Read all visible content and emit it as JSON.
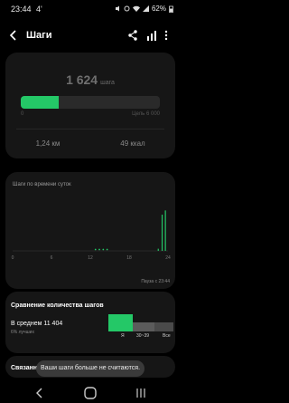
{
  "status_bar": {
    "time": "23:44",
    "notification": "4'",
    "battery": "62%"
  },
  "app_bar": {
    "title": "Шаги"
  },
  "summary": {
    "steps": "1 624",
    "steps_unit": "шага",
    "progress_start": "0",
    "goal": "Цель 6 000",
    "progress_fraction": 0.27,
    "distance": "1,24 км",
    "calories": "49 ккал",
    "accent_color": "#24c867"
  },
  "chart": {
    "title": "Шаги по времени суток",
    "pause": "Пауза с 23:44"
  },
  "chart_data": {
    "type": "bar",
    "x_ticks": [
      "0",
      "6",
      "12",
      "18",
      "24"
    ],
    "xlim": [
      0,
      24
    ],
    "bars": [
      {
        "hour": 22.5,
        "level": 0.05
      },
      {
        "hour": 23.1,
        "level": 0.85
      },
      {
        "hour": 23.6,
        "level": 0.95
      }
    ],
    "dots": [
      12.8,
      13.4,
      14.0,
      14.6
    ]
  },
  "compare": {
    "title": "Сравнение количества шагов",
    "average": "В среднем 11 404",
    "subtitle": "6% лучших",
    "segment_labels": [
      "Я",
      "30~39",
      "Все"
    ]
  },
  "bottom_card": {
    "title": "Связанные"
  },
  "toast": {
    "text": "Ваши шаги больше не считаются."
  }
}
